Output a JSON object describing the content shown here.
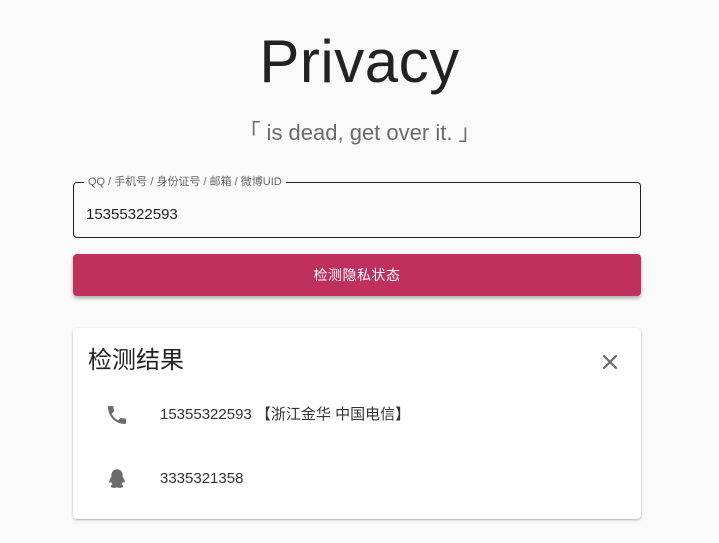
{
  "header": {
    "title": "Privacy",
    "subtitle": "「 is dead, get over it. 」"
  },
  "search": {
    "label": "QQ / 手机号 / 身份证号 / 邮箱 / 微博UID",
    "value": "15355322593"
  },
  "check_button_label": "检测隐私状态",
  "results": {
    "title": "检测结果",
    "items": [
      {
        "icon": "phone-icon",
        "text": "15355322593 【浙江金华 中国电信】"
      },
      {
        "icon": "qq-penguin-icon",
        "text": "3335321358"
      }
    ]
  },
  "colors": {
    "accent": "#c0305c",
    "icon": "#6b6b6b"
  }
}
